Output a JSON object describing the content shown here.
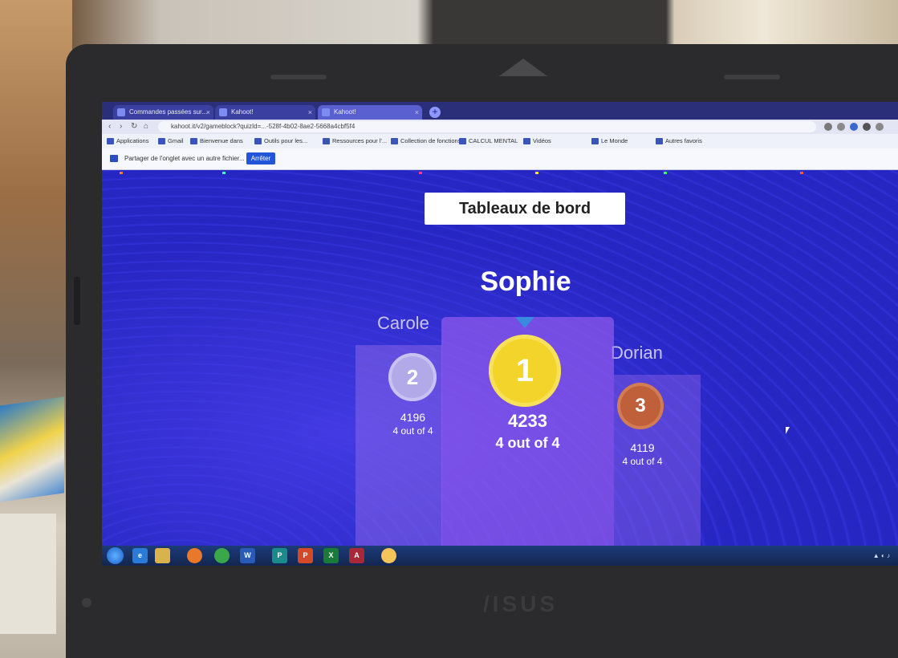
{
  "browser": {
    "tabs": [
      {
        "label": "Commandes passées sur..."
      },
      {
        "label": "Kahoot!"
      },
      {
        "label": "Kahoot!"
      }
    ],
    "url": "kahoot.it/v2/gameblock?quizId=...-528f-4b02-8ae2-5668a4cbf5f4",
    "bookmarks": [
      "Applications",
      "Gmail",
      "Bienvenue dans",
      "Outils pour les...",
      "Ressources pour l'...",
      "Collection de fonctions",
      "CALCUL MENTAL",
      "Vidéos",
      "Le Monde",
      "Autres favoris"
    ],
    "infobar": {
      "text": "Partager de l'onglet avec un autre fichier...",
      "button": "Arrêter"
    }
  },
  "page": {
    "title_button": "Tableaux de bord",
    "winner_name": "Sophie",
    "podium": [
      {
        "rank": "1",
        "name": "Sophie",
        "score": "4233",
        "out_of": "4 out of 4"
      },
      {
        "rank": "2",
        "name": "Carole",
        "score": "4196",
        "out_of": "4 out of 4"
      },
      {
        "rank": "3",
        "name": "Dorian",
        "score": "4119",
        "out_of": "4 out of 4"
      }
    ]
  },
  "laptop": {
    "brand": "/ISUS"
  },
  "colors": {
    "page_bg": "#2323b8",
    "gold": "#f3d42a",
    "silver": "#b2a9e8",
    "bronze": "#c0603a",
    "podium_purple": "#9b5ff0"
  },
  "taskbar": {
    "icons": [
      "windows-start-icon",
      "ie-icon",
      "explorer-icon",
      "firefox-icon",
      "chrome-icon",
      "word-icon",
      "publisher-icon",
      "powerpoint-icon",
      "excel-icon",
      "access-icon",
      "paint-icon"
    ]
  }
}
